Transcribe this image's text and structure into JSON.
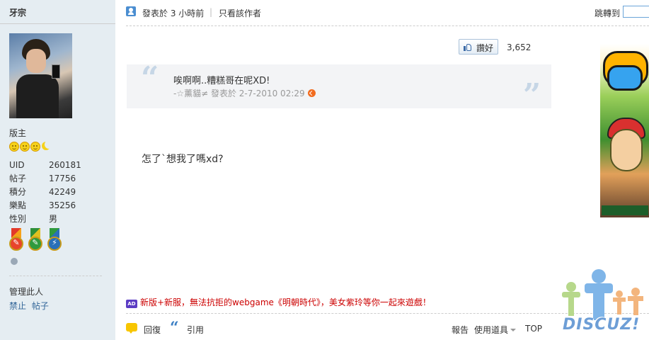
{
  "sidebar": {
    "username": "牙宗",
    "rank": "版主",
    "stats": [
      {
        "label": "UID",
        "value": "260181"
      },
      {
        "label": "帖子",
        "value": "17756"
      },
      {
        "label": "積分",
        "value": "42249"
      },
      {
        "label": "樂點",
        "value": "35256"
      },
      {
        "label": "性別",
        "value": "男"
      }
    ],
    "manage_title": "管理此人",
    "manage_links": [
      "禁止",
      "帖子"
    ]
  },
  "header": {
    "posted": "發表於 3 小時前",
    "divider": "|",
    "author_only": "只看該作者",
    "jump_label": "跳轉到"
  },
  "like": {
    "label": "讚好",
    "count": "3,652"
  },
  "quote": {
    "text": "唉啊啊..糟糕哥在呢XD!",
    "meta": "-☆薰貓≠ 發表於 2-7-2010 02:29"
  },
  "post": {
    "body": "怎了`想我了嗎xd?"
  },
  "ad": {
    "badge": "AD",
    "text": "新版+新服，無法抗拒的webgame《明朝時代》，美女紫玲等你一起來遊戲！"
  },
  "footer": {
    "reply": "回復",
    "quote": "引用",
    "report": "報告",
    "tools": "使用道具",
    "top": "TOP"
  },
  "branding": {
    "watermark": "DISCUZ!"
  },
  "icons": {
    "user": "user-icon",
    "thumb": "thumbs-up-icon",
    "reply": "reply-bubble-icon",
    "quote": "quote-icon"
  },
  "colors": {
    "sidebar_bg": "#e5edf2",
    "link": "#336699",
    "ad_text": "#cc0000",
    "quote_bg": "#f3f4f6"
  }
}
